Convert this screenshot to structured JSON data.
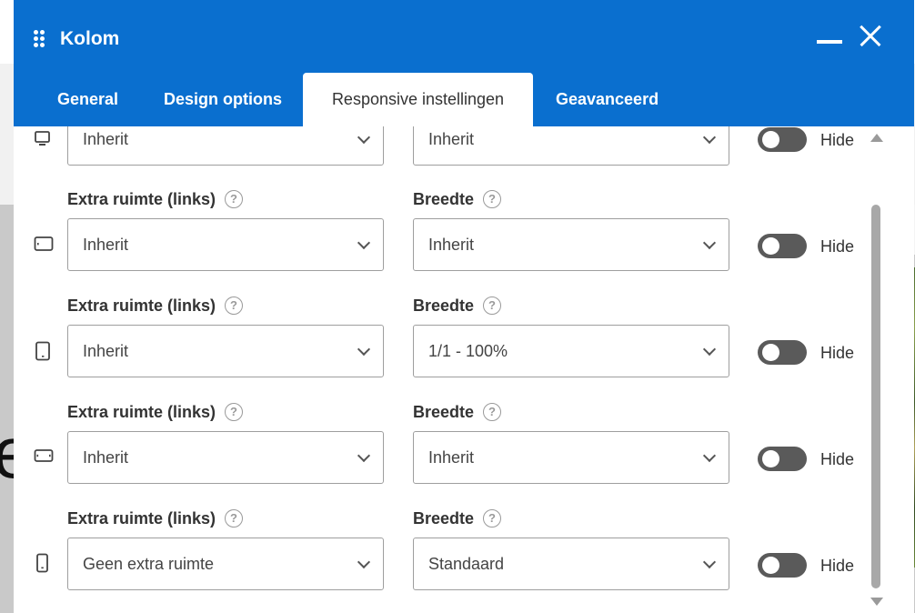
{
  "window": {
    "title": "Kolom"
  },
  "tabs": [
    {
      "label": "General",
      "active": false
    },
    {
      "label": "Design options",
      "active": false
    },
    {
      "label": "Responsive instellingen",
      "active": true
    },
    {
      "label": "Geavanceerd",
      "active": false
    }
  ],
  "rows": [
    {
      "device_icon": "desktop-icon",
      "offset_label": "",
      "offset_value": "Inherit",
      "width_label": "",
      "width_value": "Inherit",
      "hide_label": "Hide",
      "hide_enabled": false
    },
    {
      "device_icon": "tablet-landscape-icon",
      "offset_label": "Extra ruimte (links)",
      "offset_value": "Inherit",
      "width_label": "Breedte",
      "width_value": "Inherit",
      "hide_label": "Hide",
      "hide_enabled": false
    },
    {
      "device_icon": "tablet-portrait-icon",
      "offset_label": "Extra ruimte (links)",
      "offset_value": "Inherit",
      "width_label": "Breedte",
      "width_value": "1/1 - 100%",
      "hide_label": "Hide",
      "hide_enabled": false
    },
    {
      "device_icon": "mobile-landscape-icon",
      "offset_label": "Extra ruimte (links)",
      "offset_value": "Inherit",
      "width_label": "Breedte",
      "width_value": "Inherit",
      "hide_label": "Hide",
      "hide_enabled": false
    },
    {
      "device_icon": "mobile-portrait-icon",
      "offset_label": "Extra ruimte (links)",
      "offset_value": "Geen extra ruimte",
      "width_label": "Breedte",
      "width_value": "Standaard",
      "hide_label": "Hide",
      "hide_enabled": false
    }
  ],
  "help_glyph": "?",
  "background": {
    "partial_letter": "e"
  },
  "colors": {
    "header": "#0a6fcf",
    "toggle_off": "#5a5a5a"
  }
}
